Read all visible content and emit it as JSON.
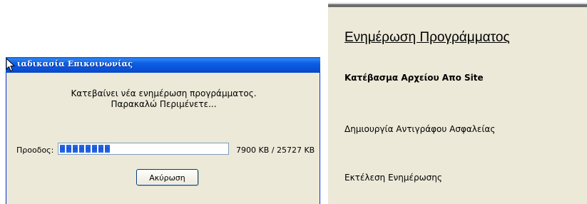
{
  "dialog": {
    "title": "ιαδικασία Επικοινωνίας",
    "message_line1": "Κατεβαίνει νέα ενημέρωση προγράμματος.",
    "message_line2": "Παρακαλώ Περιμένετε...",
    "progress_label": "Προοδος:",
    "progress_text": "7900 KB / 25727 KB",
    "progress_fraction": 0.307,
    "cancel_label": "Ακύρωση"
  },
  "panel": {
    "title": "Ενημέρωση Προγράμματος",
    "steps": [
      {
        "label": "Κατέβασμα Αρχείου Απο Site",
        "active": true
      },
      {
        "label": "Δημιουργία Αντιγράφου Ασφαλείας",
        "active": false
      },
      {
        "label": "Εκτέλεση Ενημέρωσης",
        "active": false
      }
    ]
  },
  "colors": {
    "titlebar": "#0a5bd8",
    "progress_block": "#1a55d6",
    "dialog_bg": "#ece9d8"
  },
  "icons": [
    "mouse-cursor-icon"
  ]
}
